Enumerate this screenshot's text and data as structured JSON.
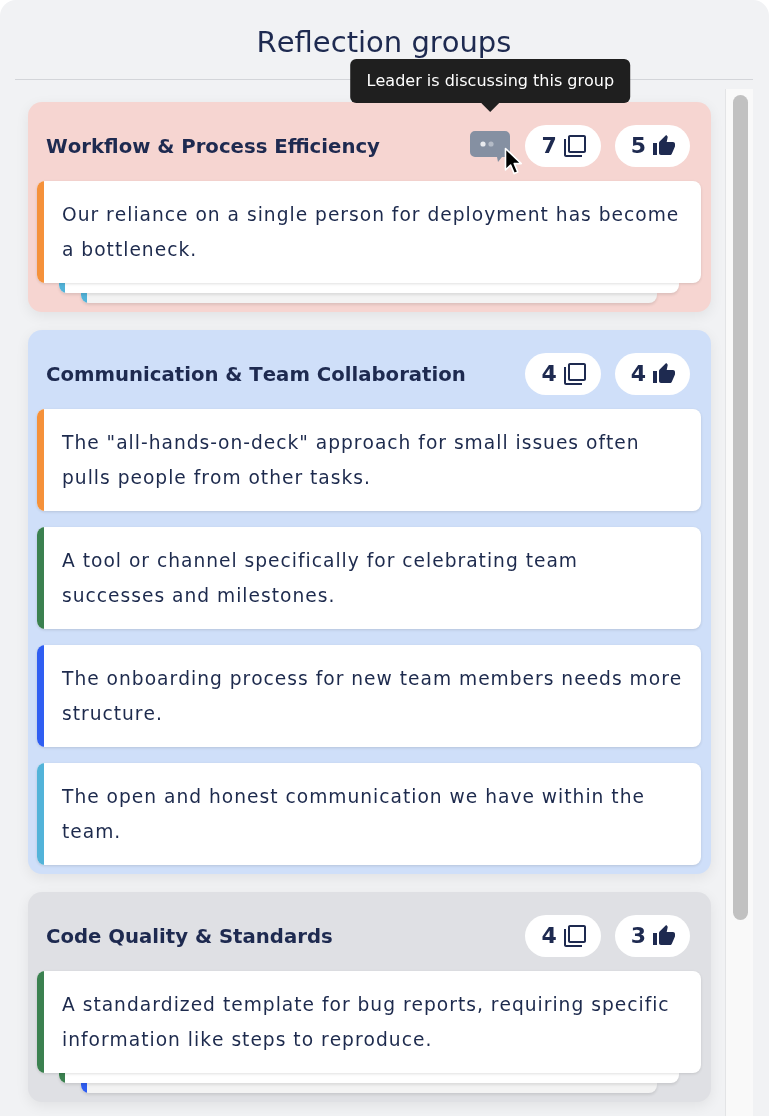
{
  "header": {
    "title": "Reflection groups"
  },
  "groups": [
    {
      "title": "Workflow & Process Efficiency",
      "color": "#f6d5d1",
      "leader_discussing": true,
      "tooltip": "Leader is discussing this group",
      "reflection_count": "7",
      "vote_count": "5",
      "cards": [
        {
          "text": "Our reliance on a single person for deployment has become a bottleneck.",
          "color": "#f5913a"
        }
      ],
      "stacked_cards": [
        {
          "color": "#52b3d9"
        },
        {
          "color": "#52b3d9"
        }
      ]
    },
    {
      "title": "Communication & Team Collaboration",
      "color": "#cfdff9",
      "leader_discussing": false,
      "reflection_count": "4",
      "vote_count": "4",
      "cards": [
        {
          "text": "The \"all-hands-on-deck\" approach for small issues often pulls people from other tasks.",
          "color": "#f5913a"
        },
        {
          "text": "A tool or channel specifically for celebrating team successes and milestones.",
          "color": "#3b8150"
        },
        {
          "text": "The onboarding process for new team members needs more structure.",
          "color": "#2f5ef2"
        },
        {
          "text": "The open and honest communication we have within the team.",
          "color": "#52b3d9"
        }
      ]
    },
    {
      "title": "Code Quality & Standards",
      "color": "#dfe0e4",
      "leader_discussing": false,
      "reflection_count": "4",
      "vote_count": "3",
      "cards": [
        {
          "text": "A standardized template for bug reports, requiring specific information like steps to reproduce.",
          "color": "#3b8150"
        }
      ],
      "stacked_cards": [
        {
          "color": "#3b8150"
        },
        {
          "color": "#2f5ef2"
        }
      ]
    }
  ]
}
